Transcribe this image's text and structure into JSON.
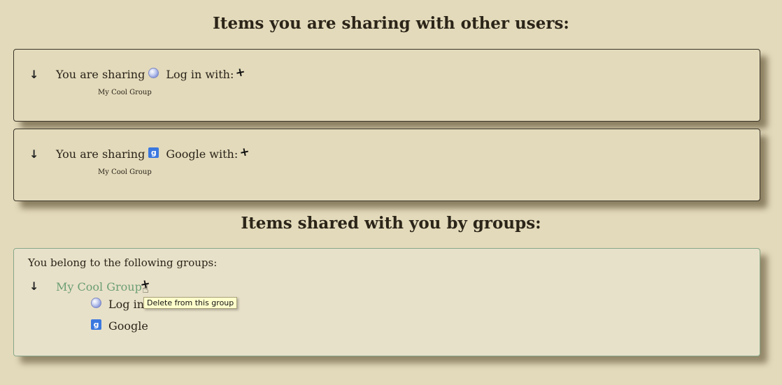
{
  "headings": {
    "outgoing": "Items you are sharing with other users:",
    "incoming": "Items shared with you by groups:"
  },
  "outgoing_shares": [
    {
      "prefix": "You are sharing",
      "icon": "globe-icon",
      "label": "Log in with:",
      "pin_glyph": "+",
      "group": "My Cool Group"
    },
    {
      "prefix": "You are sharing",
      "icon": "google-icon",
      "label": "Google with:",
      "pin_glyph": "+",
      "group": "My Cool Group"
    }
  ],
  "groups": {
    "intro": "You belong to the following groups:",
    "arrow_glyph": "↓",
    "group_name": "My Cool Group",
    "delete_glyph": "+",
    "tooltip": "Delete from this group",
    "items": [
      {
        "icon": "globe-icon",
        "label": "Log in"
      },
      {
        "icon": "google-icon",
        "label": "Google"
      }
    ]
  },
  "icons": {
    "arrow_glyph": "↓",
    "google_glyph": "g"
  },
  "colors": {
    "background": "#e3dabb",
    "group_link": "#6b9e74",
    "google_blue": "#3a78e0",
    "tooltip_bg": "#ffffcc"
  }
}
